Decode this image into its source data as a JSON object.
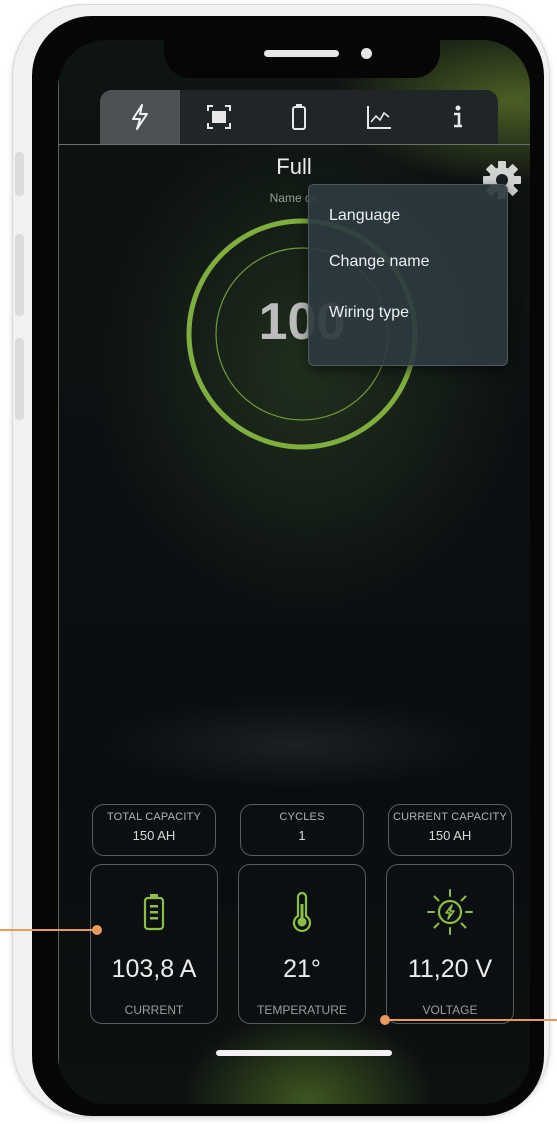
{
  "tabs": [
    {
      "name": "lightning-icon",
      "active": true
    },
    {
      "name": "scan-frame-icon",
      "active": false
    },
    {
      "name": "battery-icon",
      "active": false
    },
    {
      "name": "chart-icon",
      "active": false
    },
    {
      "name": "info-icon",
      "active": false
    }
  ],
  "header": {
    "status": "Full",
    "subtitle": "Name de"
  },
  "gauge": {
    "percent_label": "100",
    "percent": 100
  },
  "menu": {
    "items": [
      "Language",
      "Change name",
      "Wiring type"
    ]
  },
  "pills": [
    {
      "label": "TOTAL CAPACITY",
      "value": "150 AH"
    },
    {
      "label": "CYCLES",
      "value": "1"
    },
    {
      "label": "CURRENT CAPACITY",
      "value": "150 AH"
    }
  ],
  "cards": [
    {
      "value": "103,8 A",
      "label": "CURRENT",
      "icon": "battery-icon"
    },
    {
      "value": "21°",
      "label": "TEMPERATURE",
      "icon": "thermometer-icon"
    },
    {
      "value": "11,20 V",
      "label": "VOLTAGE",
      "icon": "sun-lightning-icon"
    }
  ],
  "colors": {
    "accent": "#7fae3e",
    "ring": "#7fae3e",
    "annotation": "#e89a5c",
    "background": "#0c1012"
  }
}
